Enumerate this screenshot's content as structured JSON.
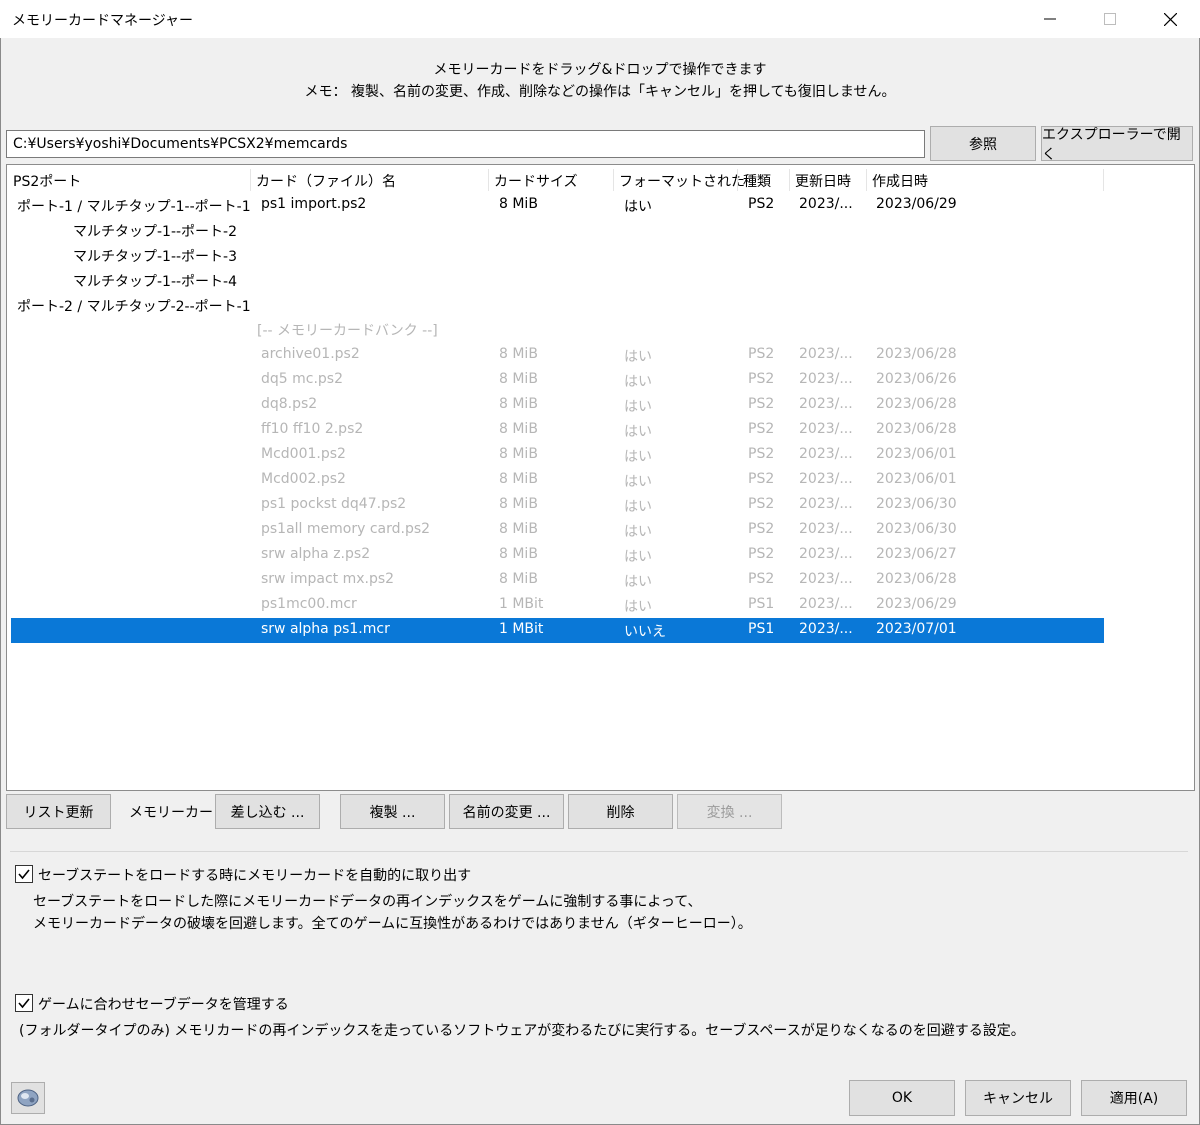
{
  "window": {
    "title": "メモリーカードマネージャー"
  },
  "instructions": {
    "line1": "メモリーカードをドラッグ&ドロップで操作できます",
    "line2": "メモ： 複製、名前の変更、作成、削除などの操作は「キャンセル」を押しても復旧しません。"
  },
  "path": {
    "value": "C:¥Users¥yoshi¥Documents¥PCSX2¥memcards",
    "browse_label": "参照",
    "explorer_label": "エクスプローラーで開く"
  },
  "columns": {
    "port": "PS2ポート",
    "name": "カード（ファイル）名",
    "size": "カードサイズ",
    "formatted": "フォーマットされた",
    "type": "種類",
    "modified": "更新日時",
    "created": "作成日時"
  },
  "ports": [
    "ポート-1 / マルチタップ-1--ポート-1",
    "マルチタップ-1--ポート-2",
    "マルチタップ-1--ポート-3",
    "マルチタップ-1--ポート-4",
    "ポート-2 / マルチタップ-2--ポート-1"
  ],
  "bank_label": "[-- メモリーカードバンク --]",
  "rows": [
    {
      "name": "ps1 import.ps2",
      "size": "8 MiB",
      "formatted": "はい",
      "type": "PS2",
      "modified": "2023/...",
      "created": "2023/06/29",
      "state": "active"
    },
    {
      "name": "archive01.ps2",
      "size": "8 MiB",
      "formatted": "はい",
      "type": "PS2",
      "modified": "2023/...",
      "created": "2023/06/28",
      "state": "dim"
    },
    {
      "name": "dq5 mc.ps2",
      "size": "8 MiB",
      "formatted": "はい",
      "type": "PS2",
      "modified": "2023/...",
      "created": "2023/06/26",
      "state": "dim"
    },
    {
      "name": "dq8.ps2",
      "size": "8 MiB",
      "formatted": "はい",
      "type": "PS2",
      "modified": "2023/...",
      "created": "2023/06/28",
      "state": "dim"
    },
    {
      "name": "ff10 ff10 2.ps2",
      "size": "8 MiB",
      "formatted": "はい",
      "type": "PS2",
      "modified": "2023/...",
      "created": "2023/06/28",
      "state": "dim"
    },
    {
      "name": "Mcd001.ps2",
      "size": "8 MiB",
      "formatted": "はい",
      "type": "PS2",
      "modified": "2023/...",
      "created": "2023/06/01",
      "state": "dim"
    },
    {
      "name": "Mcd002.ps2",
      "size": "8 MiB",
      "formatted": "はい",
      "type": "PS2",
      "modified": "2023/...",
      "created": "2023/06/01",
      "state": "dim"
    },
    {
      "name": "ps1 pockst dq47.ps2",
      "size": "8 MiB",
      "formatted": "はい",
      "type": "PS2",
      "modified": "2023/...",
      "created": "2023/06/30",
      "state": "dim"
    },
    {
      "name": "ps1all memory card.ps2",
      "size": "8 MiB",
      "formatted": "はい",
      "type": "PS2",
      "modified": "2023/...",
      "created": "2023/06/30",
      "state": "dim"
    },
    {
      "name": "srw alpha z.ps2",
      "size": "8 MiB",
      "formatted": "はい",
      "type": "PS2",
      "modified": "2023/...",
      "created": "2023/06/27",
      "state": "dim"
    },
    {
      "name": "srw impact mx.ps2",
      "size": "8 MiB",
      "formatted": "はい",
      "type": "PS2",
      "modified": "2023/...",
      "created": "2023/06/28",
      "state": "dim"
    },
    {
      "name": "ps1mc00.mcr",
      "size": "1 MBit",
      "formatted": "はい",
      "type": "PS1",
      "modified": "2023/...",
      "created": "2023/06/29",
      "state": "dim"
    },
    {
      "name": "srw alpha ps1.mcr",
      "size": "1 MBit",
      "formatted": "いいえ",
      "type": "PS1",
      "modified": "2023/...",
      "created": "2023/07/01",
      "state": "selected"
    }
  ],
  "toolbar": {
    "refresh": "リスト更新",
    "memcard_label": "メモリーカード:",
    "insert": "差し込む ...",
    "duplicate": "複製 ...",
    "rename": "名前の変更 ...",
    "delete": "削除",
    "convert": "変換 ..."
  },
  "options": {
    "eject": {
      "label": "セーブステートをロードする時にメモリーカードを自動的に取り出す",
      "checked": true,
      "desc1": "セーブステートをロードした際にメモリーカードデータの再インデックスをゲームに強制する事によって、",
      "desc2": "メモリーカードデータの破壊を回避します。全てのゲームに互換性があるわけではありません（ギターヒーロー）。"
    },
    "manage": {
      "label": "ゲームに合わせセーブデータを管理する",
      "checked": true,
      "desc1": "(フォルダータイプのみ) メモリカードの再インデックスを走っているソフトウェアが変わるたびに実行する。セーブスペースが足りなくなるのを回避する設定。"
    }
  },
  "footer": {
    "ok": "OK",
    "cancel": "キャンセル",
    "apply": "適用(A)"
  },
  "colors": {
    "selection": "#0a78d7",
    "dim_text": "#b6b6b6",
    "button_face": "#e1e1e1"
  }
}
